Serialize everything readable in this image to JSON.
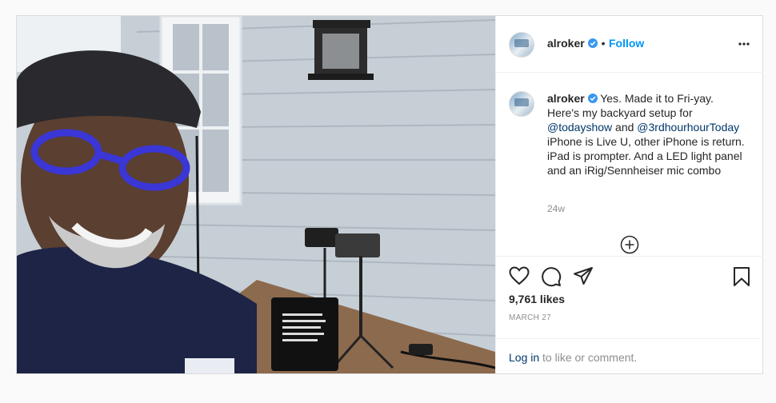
{
  "post": {
    "username": "alroker",
    "follow_label": "Follow",
    "separator": "•",
    "caption_parts": {
      "p1": "Yes. Made it to Fri-yay. Here's my backyard setup for",
      "m1": "@todayshow",
      "p2": "and",
      "m2": "@3rdhourhourToday",
      "p3": "iPhone is Live U, other iPhone is return. iPad is prompter. And a LED light panel and an iRig/Sennheiser mic combo"
    },
    "time_ago": "24w",
    "likes": "9,761 likes",
    "date": "MARCH 27",
    "login_link": "Log in",
    "login_rest": "to like or comment."
  },
  "icons": {
    "verified": "verified-badge-icon",
    "more": "more-options-icon",
    "add_comment": "add-comment-icon",
    "like": "heart-icon",
    "comment": "comment-icon",
    "share": "share-icon",
    "save": "bookmark-icon"
  },
  "colors": {
    "accent": "#0095f6",
    "mention": "#00376b",
    "muted": "#8e8e8e",
    "border": "#dbdbdb"
  }
}
